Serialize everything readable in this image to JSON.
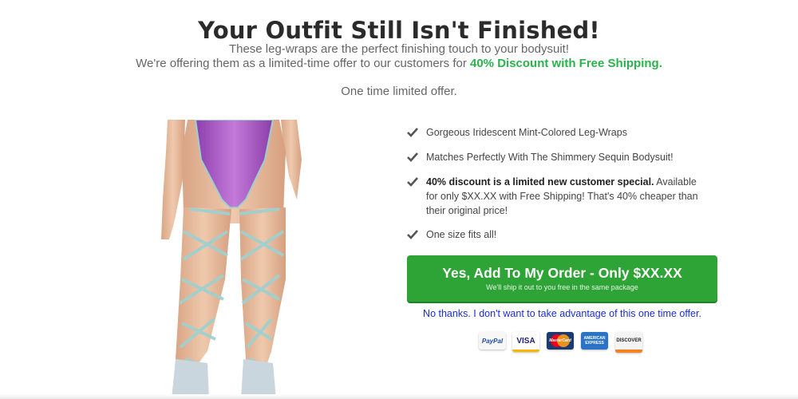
{
  "headline": "Your Outfit Still Isn't Finished!",
  "intro": {
    "line1": "These leg-wraps are the perfect finishing touch to your bodysuit!",
    "line2_prefix": "We're offering them as a limited-time offer to our customers for ",
    "line2_highlight": "40% Discount with Free Shipping.",
    "line3": "One time limited offer."
  },
  "features": [
    {
      "bold": "",
      "text": "Gorgeous Iridescent Mint-Colored Leg-Wraps"
    },
    {
      "bold": "",
      "text": "Matches Perfectly With The Shimmery Sequin Bodysuit!"
    },
    {
      "bold": "40% discount is a limited new customer special.",
      "text": " Available for only $XX.XX with Free Shipping! That's 40% cheaper than their original price!"
    },
    {
      "bold": "",
      "text": "One size fits all!"
    }
  ],
  "cta": {
    "label": "Yes, Add To My Order - Only $XX.XX",
    "sublabel": "We'll ship it out to you free in the same package"
  },
  "decline": "No thanks. I don't want to take advantage of this one time offer.",
  "payment_cards": [
    {
      "name": "PayPal",
      "label": "PayPal"
    },
    {
      "name": "Visa",
      "label": "VISA"
    },
    {
      "name": "MasterCard",
      "label": "MasterCard"
    },
    {
      "name": "American Express",
      "label": "AMERICAN EXPRESS"
    },
    {
      "name": "Discover",
      "label": "DISCOVER"
    }
  ],
  "icons": {
    "feature_bullet": "check-icon",
    "product": "leg-wraps-product-image"
  },
  "colors": {
    "cta": "#2ea336",
    "highlight": "#2bb24c",
    "decline_link": "#1a2dd1",
    "bodysuit": "#a04fc0",
    "wraps": "#9fd0cf"
  }
}
